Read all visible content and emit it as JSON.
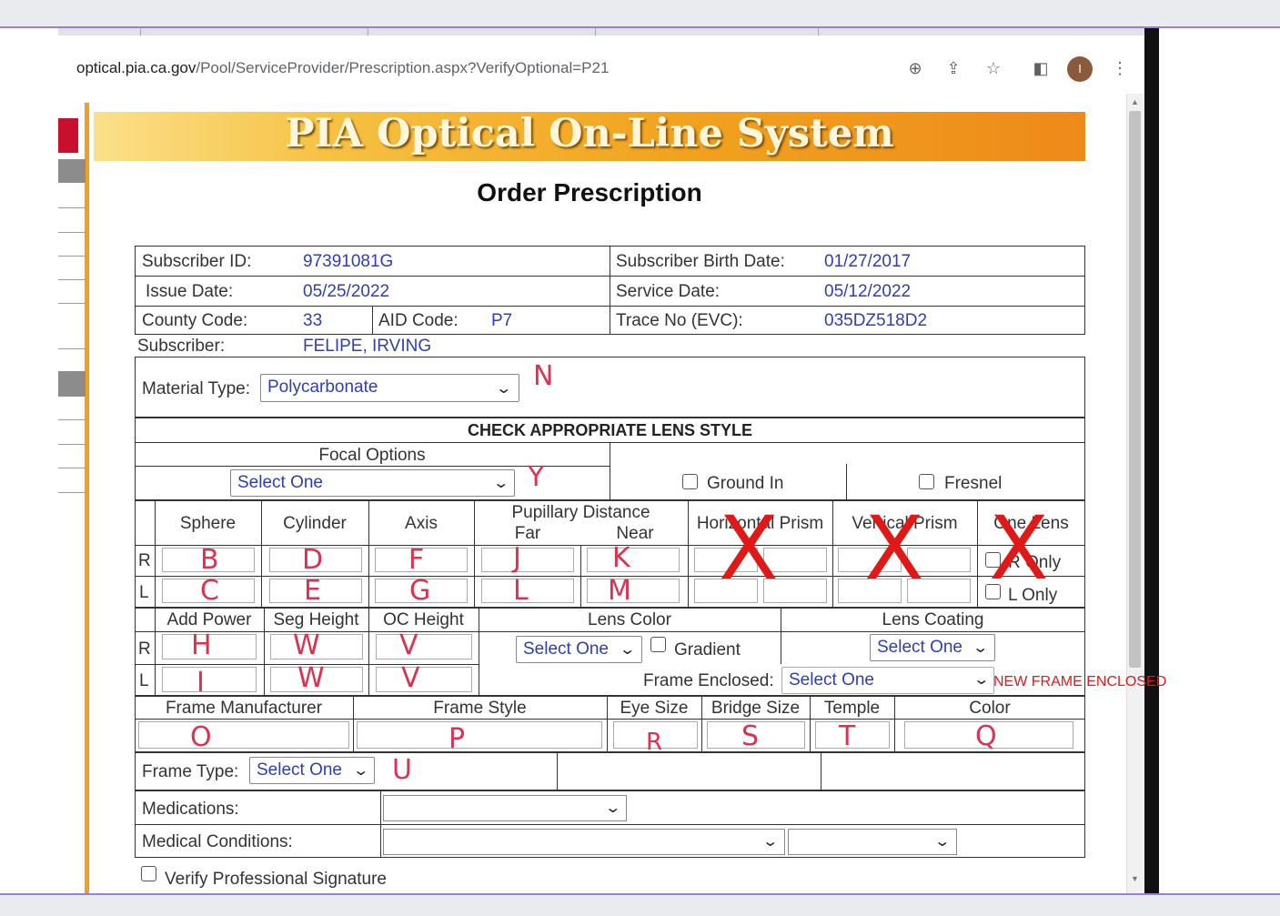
{
  "browser": {
    "url_host": "optical.pia.ca.gov",
    "url_path": "/Pool/ServiceProvider/Prescription.aspx?VerifyOptional=P21",
    "avatar_initial": "I"
  },
  "banner": {
    "title": "PIA Optical On-Line System"
  },
  "page": {
    "title": "Order Prescription"
  },
  "subscriber": {
    "id_label": "Subscriber ID:",
    "id_value": "97391081G",
    "birth_label": "Subscriber Birth Date:",
    "birth_value": "01/27/2017",
    "issue_label": "Issue Date:",
    "issue_value": "05/25/2022",
    "service_label": "Service Date:",
    "service_value": "05/12/2022",
    "county_label": "County Code:",
    "county_value": "33",
    "aid_label": "AID Code:",
    "aid_value": "P7",
    "trace_label": "Trace No (EVC):",
    "trace_value": "035DZ518D2",
    "name_label": "Subscriber:",
    "name_value": "FELIPE, IRVING"
  },
  "material": {
    "label": "Material Type:",
    "value": "Polycarbonate"
  },
  "lens_style": {
    "header": "CHECK APPROPRIATE LENS STYLE",
    "focal_label": "Focal Options",
    "focal_value": "Select One",
    "ground_in": "Ground In",
    "fresnel": "Fresnel"
  },
  "rx_headers": {
    "sphere": "Sphere",
    "cylinder": "Cylinder",
    "axis": "Axis",
    "pd": "Pupillary Distance",
    "far": "Far",
    "near": "Near",
    "hprism": "Horizontal Prism",
    "vprism": "Vertical Prism",
    "onelens": "One Lens",
    "r": "R",
    "l": "L",
    "r_only": "R Only",
    "l_only": "L Only"
  },
  "add_headers": {
    "add_power": "Add Power",
    "seg_height": "Seg Height",
    "oc_height": "OC Height",
    "lens_color": "Lens Color",
    "lens_coating": "Lens Coating",
    "color_select": "Select One",
    "gradient": "Gradient",
    "coating_select": "Select One",
    "frame_enclosed_label": "Frame Enclosed:",
    "frame_enclosed_value": "Select One"
  },
  "frame": {
    "manufacturer": "Frame Manufacturer",
    "style": "Frame Style",
    "eye_size": "Eye Size",
    "bridge_size": "Bridge Size",
    "temple": "Temple",
    "color": "Color",
    "type_label": "Frame Type:",
    "type_value": "Select One"
  },
  "medical": {
    "medications": "Medications:",
    "conditions": "Medical Conditions:",
    "verify": "Verify Professional Signature"
  },
  "annotations": {
    "N": "N",
    "Y": "Y",
    "B": "B",
    "C": "C",
    "D": "D",
    "E": "E",
    "F": "F",
    "G": "G",
    "J": "J",
    "K": "K",
    "L": "L",
    "M": "M",
    "H": "H",
    "I": "I",
    "W1": "W",
    "W2": "W",
    "V1": "V",
    "V2": "V",
    "O": "O",
    "P": "P",
    "R": "R",
    "S": "S",
    "T": "T",
    "Q": "Q",
    "U": "U",
    "x_mark": "X",
    "new_frame": "NEW FRAME  ENCLOSED"
  }
}
